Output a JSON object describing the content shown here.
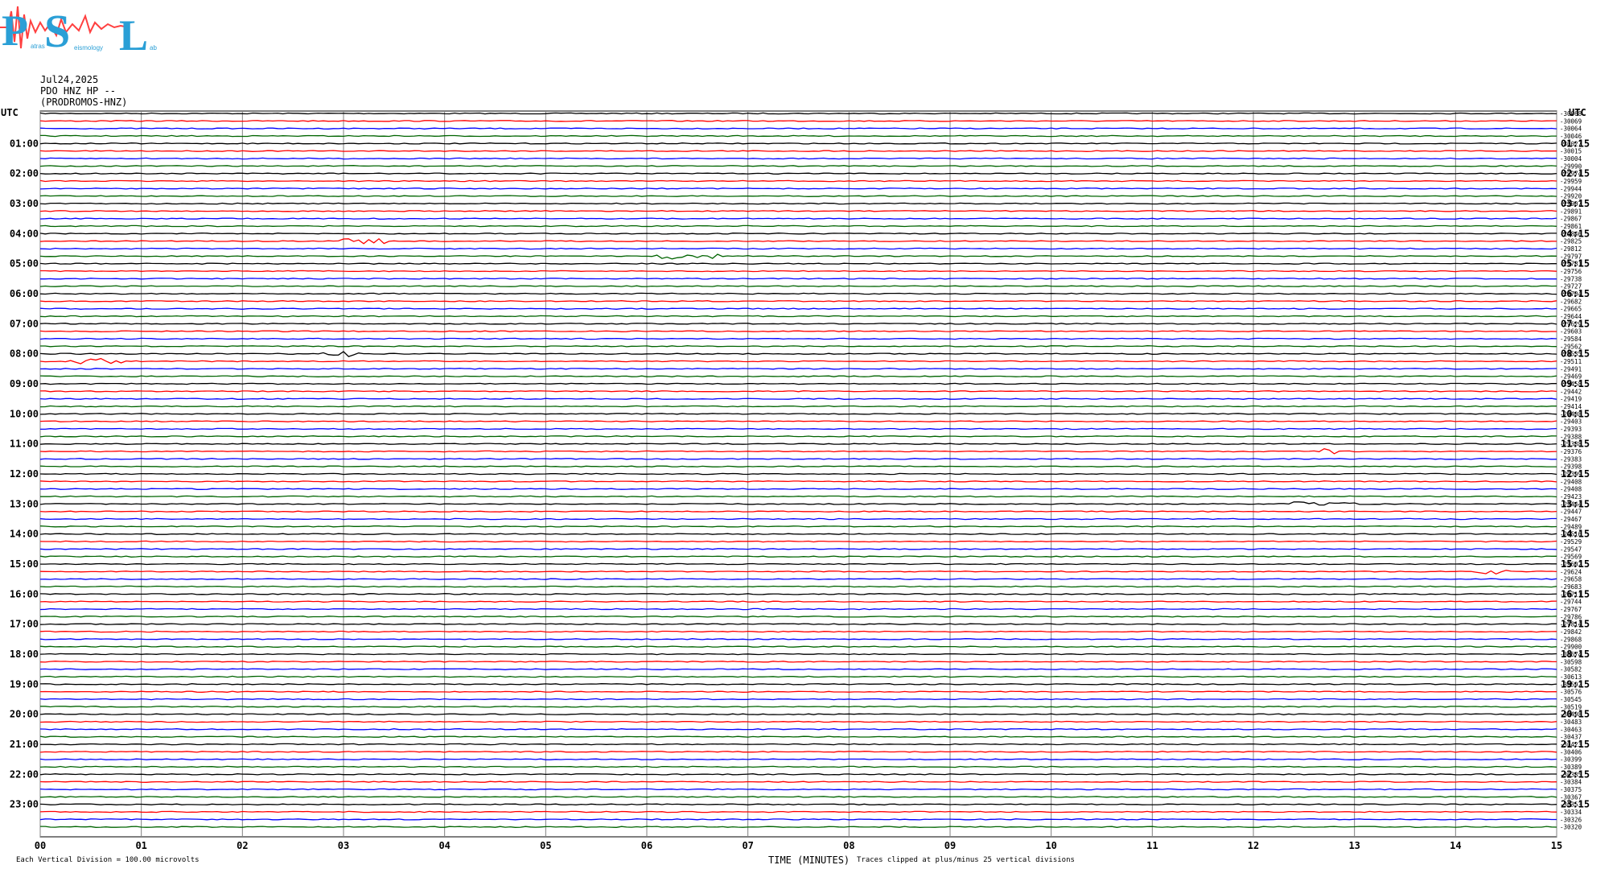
{
  "header": {
    "logo_text": "PSL",
    "logo_words": [
      "atras",
      "eismology",
      "ab"
    ],
    "date": "Jul24,2025",
    "station": "PDO HNZ HP --",
    "site": "(PRODROMOS-HNZ)"
  },
  "chart_data": {
    "type": "line",
    "title": "",
    "left_axis_label": "UTC",
    "right_axis_label": "UTC",
    "left_hour_labels": [
      "01:00",
      "02:00",
      "03:00",
      "04:00",
      "05:00",
      "06:00",
      "07:00",
      "08:00",
      "09:00",
      "10:00",
      "11:00",
      "12:00",
      "13:00",
      "14:00",
      "15:00",
      "16:00",
      "17:00",
      "18:00",
      "19:00",
      "20:00",
      "21:00",
      "22:00",
      "23:00"
    ],
    "right_hour_labels": [
      "01:15",
      "02:15",
      "03:15",
      "04:15",
      "05:15",
      "06:15",
      "07:15",
      "08:15",
      "09:15",
      "10:15",
      "11:15",
      "12:15",
      "13:15",
      "14:15",
      "15:15",
      "16:15",
      "17:15",
      "18:15",
      "19:15",
      "20:15",
      "21:15",
      "22:15",
      "23:15"
    ],
    "x_ticks": [
      "00",
      "01",
      "02",
      "03",
      "04",
      "05",
      "06",
      "07",
      "08",
      "09",
      "10",
      "11",
      "12",
      "13",
      "14",
      "15"
    ],
    "xlabel": "TIME (MINUTES)",
    "xlim": [
      0,
      15
    ],
    "trace_count": 96,
    "trace_colors": [
      "#000000",
      "#ff0000",
      "#0000ff",
      "#006400"
    ],
    "trace_offsets": [
      -30068,
      -30069,
      -30064,
      -30046,
      -30027,
      -30015,
      -30004,
      -29990,
      -29974,
      -29959,
      -29944,
      -29920,
      -29907,
      -29891,
      -29867,
      -29861,
      -29846,
      -29825,
      -29812,
      -29797,
      -29781,
      -29756,
      -29738,
      -29727,
      -29704,
      -29682,
      -29665,
      -29644,
      -29629,
      -29603,
      -29584,
      -29562,
      -29535,
      -29511,
      -29491,
      -29469,
      -29458,
      -29442,
      -29419,
      -29414,
      -29408,
      -29403,
      -29393,
      -29388,
      -29388,
      -29376,
      -29383,
      -29398,
      -29399,
      -29408,
      -29408,
      -29423,
      -29444,
      -29447,
      -29467,
      -29489,
      -29516,
      -29529,
      -29547,
      -29569,
      -29602,
      -29624,
      -29658,
      -29683,
      -29711,
      -29744,
      -29767,
      -29786,
      -29814,
      -29842,
      -29868,
      -29900,
      -30674,
      -30598,
      -30582,
      -30613,
      -30592,
      -30576,
      -30545,
      -30519,
      -30498,
      -30483,
      -30463,
      -30437,
      -30423,
      -30406,
      -30399,
      -30389,
      -30385,
      -30384,
      -30375,
      -30367,
      -30353,
      -30334,
      -30326,
      -30320
    ],
    "events": [
      {
        "trace": 17,
        "start_min": 3.0,
        "end_min": 3.4
      },
      {
        "trace": 19,
        "start_min": 6.1,
        "end_min": 6.7
      },
      {
        "trace": 32,
        "start_min": 2.8,
        "end_min": 3.2
      },
      {
        "trace": 33,
        "start_min": 0.3,
        "end_min": 0.9
      },
      {
        "trace": 45,
        "start_min": 12.7,
        "end_min": 12.8
      },
      {
        "trace": 52,
        "start_min": 12.4,
        "end_min": 13.0
      },
      {
        "trace": 61,
        "start_min": 14.2,
        "end_min": 14.5
      }
    ],
    "footer_left": "Each Vertical Division =  100.00 microvolts",
    "footer_right": "Traces clipped at plus/minus 25 vertical divisions"
  }
}
